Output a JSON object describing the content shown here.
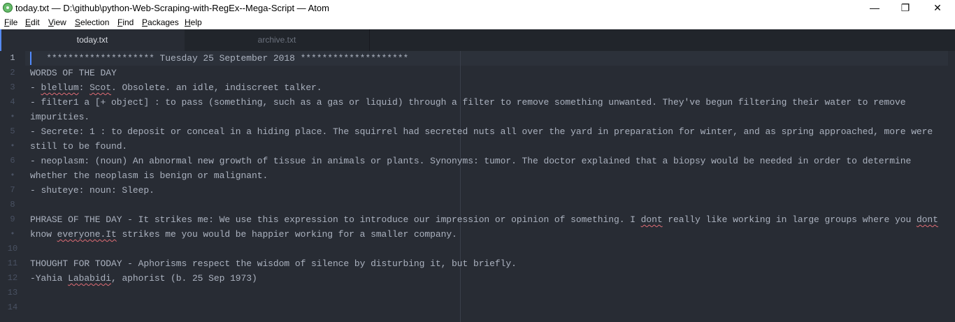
{
  "window": {
    "title": "today.txt — D:\\github\\python-Web-Scraping-with-RegEx--Mega-Script — Atom",
    "minimize": "—",
    "restore": "❐",
    "close": "✕"
  },
  "menu": [
    {
      "label": "File",
      "mnemonic": "F",
      "rest": "ile"
    },
    {
      "label": "Edit",
      "mnemonic": "E",
      "rest": "dit"
    },
    {
      "label": "View",
      "mnemonic": "V",
      "rest": "iew"
    },
    {
      "label": "Selection",
      "mnemonic": "S",
      "rest": "election"
    },
    {
      "label": "Find",
      "mnemonic": "F",
      "rest": "ind"
    },
    {
      "label": "Packages",
      "mnemonic": "P",
      "rest": "ackages"
    },
    {
      "label": "Help",
      "mnemonic": "H",
      "rest": "elp"
    }
  ],
  "tabs": [
    {
      "label": "today.txt",
      "active": true
    },
    {
      "label": "archive.txt",
      "active": false
    }
  ],
  "editor": {
    "gutter": [
      "1",
      "2",
      "3",
      "4",
      "•",
      "5",
      "•",
      "6",
      "•",
      "7",
      "8",
      "9",
      "•",
      "10",
      "11",
      "12",
      "13",
      "14"
    ],
    "active_line": "1",
    "lines": [
      [
        {
          "t": "   ******************** Tuesday 25 September 2018 ********************"
        }
      ],
      [
        {
          "t": "WORDS OF THE DAY"
        }
      ],
      [
        {
          "t": "- "
        },
        {
          "t": "blellum",
          "sp": true
        },
        {
          "t": ": "
        },
        {
          "t": "Scot",
          "sp": true
        },
        {
          "t": ". Obsolete. an idle, indiscreet talker."
        }
      ],
      [
        {
          "t": "- filter1 a [+ object] : to pass (something, such as a gas or liquid) through a filter to remove something unwanted. They've begun filtering their water to remove"
        }
      ],
      [
        {
          "t": "impurities."
        }
      ],
      [
        {
          "t": "- Secrete: 1 : to deposit or conceal in a hiding place. The squirrel had secreted nuts all over the yard in preparation for winter, and as spring approached, more were"
        }
      ],
      [
        {
          "t": "still to be found."
        }
      ],
      [
        {
          "t": "- neoplasm: (noun) An abnormal new growth of tissue in animals or plants. Synonyms: tumor. The doctor explained that a biopsy would be needed in order to determine"
        }
      ],
      [
        {
          "t": "whether the neoplasm is benign or malignant."
        }
      ],
      [
        {
          "t": "- shuteye: noun: Sleep."
        }
      ],
      [
        {
          "t": ""
        }
      ],
      [
        {
          "t": "PHRASE OF THE DAY - It strikes me: We use this expression to introduce our impression or opinion of something. I "
        },
        {
          "t": "dont",
          "sp": true
        },
        {
          "t": " really like working in large groups where you "
        },
        {
          "t": "dont",
          "sp": true
        }
      ],
      [
        {
          "t": "know "
        },
        {
          "t": "everyone.It",
          "sp": true
        },
        {
          "t": " strikes me you would be happier working for a smaller company."
        }
      ],
      [
        {
          "t": ""
        }
      ],
      [
        {
          "t": "THOUGHT FOR TODAY - Aphorisms respect the wisdom of silence by disturbing it, but briefly."
        }
      ],
      [
        {
          "t": "-Yahia "
        },
        {
          "t": "Lababidi",
          "sp": true
        },
        {
          "t": ", aphorist (b. 25 Sep 1973)"
        }
      ],
      [
        {
          "t": ""
        }
      ],
      [
        {
          "t": ""
        }
      ]
    ]
  }
}
